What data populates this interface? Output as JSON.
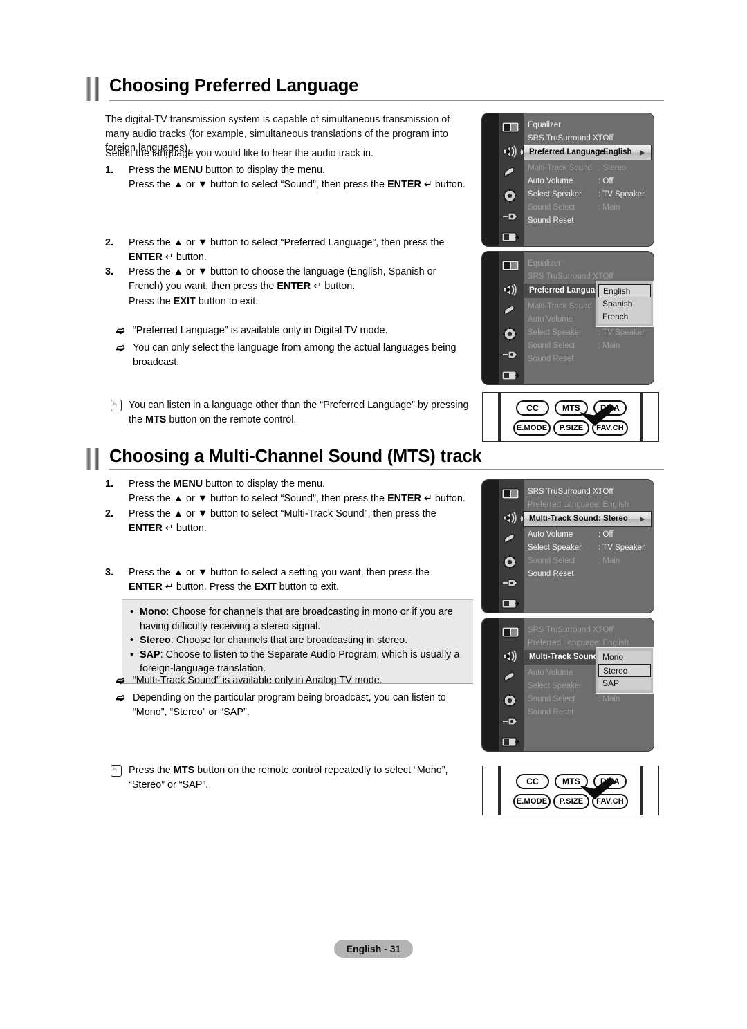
{
  "document": {
    "footer_label": "English - 31"
  },
  "section1": {
    "title": "Choosing Preferred Language",
    "intro_1": "The digital-TV transmission system is capable of simultaneous transmission of many audio tracks (for example, simultaneous translations of the program into foreign languages).",
    "intro_2": "Select the language you would like to hear the audio track in.",
    "steps": [
      {
        "num": "1.",
        "line1_a": "Press the ",
        "line1_b": "MENU",
        "line1_c": " button to display the menu.",
        "line2_a": "Press the ▲ or ▼ button to select “Sound”, then press the ",
        "line2_b": "ENTER",
        "line2_c": " ↵ button."
      },
      {
        "num": "2.",
        "line1_a": "Press the ▲ or ▼ button to select “Preferred Language”, then press the ",
        "line1_b": "ENTER",
        "line1_c": " ↵ button."
      },
      {
        "num": "3.",
        "line1_a": "Press the ▲ or ▼ button to choose the language (English, Spanish or French) you want, then press the ",
        "line1_b": "ENTER",
        "line1_c": " ↵ button.",
        "line2_a": "Press the ",
        "line2_b": "EXIT",
        "line2_c": " button to exit."
      }
    ],
    "notes": [
      "“Preferred Language” is available only in Digital TV mode.",
      "You can only select the language from among the actual languages being broadcast."
    ],
    "tip": {
      "text_a": "You can listen in a language other than the “Preferred Language” by pressing the ",
      "text_b": "MTS",
      "text_c": " button on the remote control."
    }
  },
  "section2": {
    "title": "Choosing a Multi-Channel Sound (MTS) track",
    "steps": [
      {
        "num": "1.",
        "line1_a": "Press the ",
        "line1_b": "MENU",
        "line1_c": " button to display the menu.",
        "line2_a": "Press the ▲ or ▼ button to select “Sound”, then press the ",
        "line2_b": "ENTER",
        "line2_c": " ↵ button."
      },
      {
        "num": "2.",
        "line1_a": "Press the ▲ or ▼ button to select “Multi-Track Sound”, then press the ",
        "line1_b": "ENTER",
        "line1_c": " ↵ button."
      },
      {
        "num": "3.",
        "line1_a": "Press the ▲ or ▼ button to select a setting you want, then press the ",
        "line1_b": "ENTER",
        "line1_c": " ↵ button. Press the ",
        "line1_d": "EXIT",
        "line1_e": " button to exit."
      }
    ],
    "options_box": [
      {
        "term": "Mono",
        "desc": ": Choose for channels that are broadcasting in mono or if you are having difficulty receiving a stereo signal."
      },
      {
        "term": "Stereo",
        "desc": ": Choose for channels that are broadcasting in stereo."
      },
      {
        "term": "SAP",
        "desc": ": Choose to listen to the Separate Audio Program, which is usually a foreign-language translation."
      }
    ],
    "notes": [
      "“Multi-Track Sound” is available only in Analog TV mode.",
      "Depending on the particular program being broadcast, you can listen to “Mono”, “Stereo” or “SAP”."
    ],
    "tip": {
      "text_a": "Press the ",
      "text_b": "MTS",
      "text_c": " button on the remote control repeatedly to select “Mono”, “Stereo” or “SAP”."
    }
  },
  "osd": {
    "rail_label": "Sound",
    "panel1": {
      "rows": [
        {
          "label": "Equalizer",
          "value": "",
          "state": "normal"
        },
        {
          "label": "SRS TruSurround XT",
          "value": ": Off",
          "state": "normal"
        },
        {
          "label": "Preferred Language",
          "value": ": English",
          "state": "highlight"
        },
        {
          "label": "Multi-Track Sound",
          "value": ": Stereo",
          "state": "dim"
        },
        {
          "label": "Auto Volume",
          "value": ": Off",
          "state": "normal"
        },
        {
          "label": "Select Speaker",
          "value": ": TV Speaker",
          "state": "normal"
        },
        {
          "label": "Sound Select",
          "value": ": Main",
          "state": "dim"
        },
        {
          "label": "Sound Reset",
          "value": "",
          "state": "normal"
        }
      ]
    },
    "panel2": {
      "rows": [
        {
          "label": "Equalizer",
          "value": "",
          "state": "dim"
        },
        {
          "label": "SRS TruSurround XT",
          "value": ": Off",
          "state": "dim"
        },
        {
          "label": "Preferred Language",
          "value": ":",
          "state": "seltitle"
        },
        {
          "label": "Multi-Track Sound",
          "value": ":",
          "state": "dim"
        },
        {
          "label": "Auto Volume",
          "value": ":",
          "state": "dim"
        },
        {
          "label": "Select Speaker",
          "value": ": TV Speaker",
          "state": "dim"
        },
        {
          "label": "Sound Select",
          "value": ": Main",
          "state": "dim"
        },
        {
          "label": "Sound Reset",
          "value": "",
          "state": "dim"
        }
      ],
      "options": [
        {
          "label": "English",
          "selected": true
        },
        {
          "label": "Spanish",
          "selected": false
        },
        {
          "label": "French",
          "selected": false
        }
      ]
    },
    "panel3": {
      "rows": [
        {
          "label": "SRS TruSurround XT",
          "value": ": Off",
          "state": "normal"
        },
        {
          "label": "Preferred Language",
          "value": ": English",
          "state": "dim"
        },
        {
          "label": "Multi-Track Sound",
          "value": ": Stereo",
          "state": "highlight"
        },
        {
          "label": "Auto Volume",
          "value": ": Off",
          "state": "normal"
        },
        {
          "label": "Select Speaker",
          "value": ": TV Speaker",
          "state": "normal"
        },
        {
          "label": "Sound Select",
          "value": ": Main",
          "state": "dim"
        },
        {
          "label": "Sound Reset",
          "value": "",
          "state": "normal"
        }
      ]
    },
    "panel4": {
      "rows": [
        {
          "label": "SRS TruSurround XT",
          "value": ": Off",
          "state": "dim"
        },
        {
          "label": "Preferred Language",
          "value": ": English",
          "state": "dim"
        },
        {
          "label": "Multi-Track Sound",
          "value": ":",
          "state": "seltitle"
        },
        {
          "label": "Auto Volume",
          "value": ":",
          "state": "dim"
        },
        {
          "label": "Select Speaker",
          "value": ":",
          "state": "dim"
        },
        {
          "label": "Sound Select",
          "value": ": Main",
          "state": "dim"
        },
        {
          "label": "Sound Reset",
          "value": "",
          "state": "dim"
        }
      ],
      "options": [
        {
          "label": "Mono",
          "selected": false
        },
        {
          "label": "Stereo",
          "selected": true
        },
        {
          "label": "SAP",
          "selected": false
        }
      ]
    },
    "icons": [
      "picture-icon",
      "sound-icon",
      "channel-icon",
      "setup-icon",
      "input-icon",
      "media-icon"
    ]
  },
  "remote": {
    "buttons_top": [
      "CC",
      "MTS",
      "DMA"
    ],
    "buttons_bottom": [
      "E.MODE",
      "P.SIZE",
      "FAV.CH"
    ]
  }
}
